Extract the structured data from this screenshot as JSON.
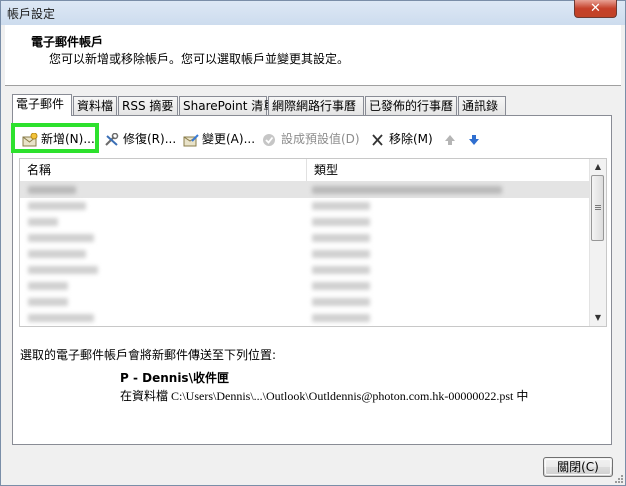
{
  "window": {
    "title": "帳戶設定",
    "close_glyph": "✕"
  },
  "header": {
    "title": "電子郵件帳戶",
    "subtitle": "您可以新增或移除帳戶。您可以選取帳戶並變更其設定。"
  },
  "tabs": [
    {
      "label": "電子郵件",
      "active": true
    },
    {
      "label": "資料檔"
    },
    {
      "label": "RSS 摘要"
    },
    {
      "label": "SharePoint 清單"
    },
    {
      "label": "網際網路行事曆"
    },
    {
      "label": "已發佈的行事曆"
    },
    {
      "label": "通訊錄"
    }
  ],
  "toolbar": {
    "new_label": "新增(N)...",
    "repair_label": "修復(R)...",
    "change_label": "變更(A)...",
    "default_label": "設成預設值(D)",
    "remove_label": "移除(M)",
    "up_icon": "arrow-up-icon",
    "down_icon": "arrow-down-icon"
  },
  "list": {
    "columns": [
      "名稱",
      "類型"
    ],
    "row_count": 9,
    "selected_row": 0
  },
  "destination": {
    "label": "選取的電子郵件帳戶會將新郵件傳送至下列位置:",
    "mailbox": "P - Dennis\\收件匣",
    "path": "在資料檔 C:\\Users\\Dennis\\...\\Outlook\\Outldennis@photon.com.hk-00000022.pst 中"
  },
  "footer": {
    "close_label": "關閉(C)"
  },
  "colors": {
    "highlight": "#2de12d",
    "selection": "#e4e4e4",
    "titlebar": "#dde8f5"
  }
}
